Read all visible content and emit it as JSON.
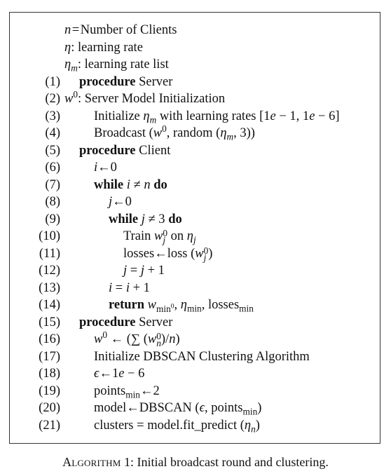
{
  "header_lines": [
    "n = Number of Clients",
    "η: learning rate",
    "ηm: learning rate list"
  ],
  "lines": [
    {
      "num": "(1)",
      "text": "procedure Server"
    },
    {
      "num": "(2)",
      "text": "w0: Server Model Initialization"
    },
    {
      "num": "(3)",
      "text": "Initialize ηm with learning rates [1e − 1, 1e − 6]"
    },
    {
      "num": "(4)",
      "text": "Broadcast (w0, random (ηm, 3))"
    },
    {
      "num": "(5)",
      "text": "procedure Client"
    },
    {
      "num": "(6)",
      "text": "i←0"
    },
    {
      "num": "(7)",
      "text": "while i ≠ n do"
    },
    {
      "num": "(8)",
      "text": "j←0"
    },
    {
      "num": "(9)",
      "text": "while j ≠ 3 do"
    },
    {
      "num": "(10)",
      "text": "Train wj0 on ηj"
    },
    {
      "num": "(11)",
      "text": "losses←loss (wj0)"
    },
    {
      "num": "(12)",
      "text": "j = j + 1"
    },
    {
      "num": "(13)",
      "text": "i = i + 1"
    },
    {
      "num": "(14)",
      "text": "return wmin0, ηmin, lossesmin"
    },
    {
      "num": "(15)",
      "text": "procedure Server"
    },
    {
      "num": "(16)",
      "text": "w0 ← (∑ (wn0)/n)"
    },
    {
      "num": "(17)",
      "text": "Initialize DBSCAN Clustering Algorithm"
    },
    {
      "num": "(18)",
      "text": "ϵ←1e − 6"
    },
    {
      "num": "(19)",
      "text": "pointsmin←2"
    },
    {
      "num": "(20)",
      "text": "model←DBSCAN (ϵ, pointsmin)"
    },
    {
      "num": "(21)",
      "text": "clusters = model.fit_predict (ηn)"
    }
  ],
  "caption": {
    "label": "Algorithm",
    "number": "1:",
    "text": "Initial broadcast round and clustering."
  }
}
